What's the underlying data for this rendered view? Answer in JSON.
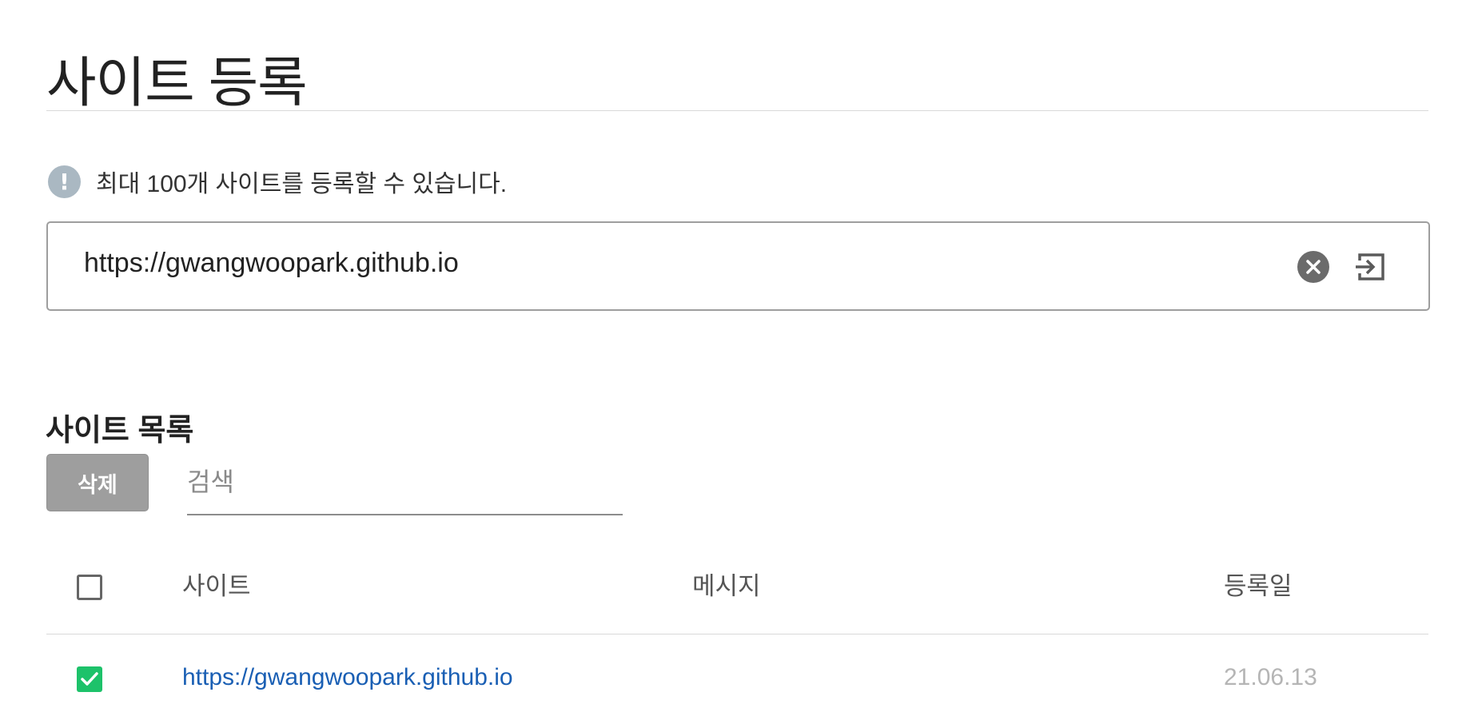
{
  "header": {
    "title": "사이트 등록"
  },
  "notice": {
    "icon": "exclamation-icon",
    "text": "최대 100개 사이트를 등록할 수 있습니다."
  },
  "url_input": {
    "value": "https://gwangwoopark.github.io",
    "clear_icon": "close-circle-icon",
    "submit_icon": "enter-icon"
  },
  "site_list": {
    "title": "사이트 목록",
    "delete_label": "삭제",
    "search_placeholder": "검색",
    "columns": {
      "site": "사이트",
      "message": "메시지",
      "date": "등록일"
    },
    "select_all_checked": false,
    "rows": [
      {
        "site": "https://gwangwoopark.github.io",
        "message": "",
        "date": "21.06.13",
        "checked": true
      }
    ]
  },
  "colors": {
    "checkbox_checked": "#1dc26a",
    "link": "#1a5fb4",
    "delete_button": "#9e9e9e",
    "notice_icon": "#aab8c2"
  }
}
